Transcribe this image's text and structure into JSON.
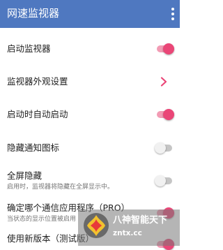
{
  "app": {
    "title": "网速监视器",
    "menu_icon": "more-vert-icon"
  },
  "colors": {
    "appbar": "#4f78c0",
    "accent": "#ea4677"
  },
  "settings": {
    "items": [
      {
        "label": "启动监视器",
        "control": "switch",
        "state": "on"
      },
      {
        "label": "监视器外观设置",
        "control": "chevron-right-icon"
      },
      {
        "label": "启动时自动启动",
        "control": "switch",
        "state": "on"
      },
      {
        "label": "隐藏通知图标",
        "control": "switch",
        "state": "off"
      },
      {
        "label": "全屏隐藏",
        "summary": "启用时，监视器将隐藏在全屏显示中。",
        "control": "switch",
        "state": "off"
      },
      {
        "label": "确定哪个通信应用程序（PRO）",
        "summary": "当状态的显示位置被启用",
        "control": "switch",
        "state": "on"
      },
      {
        "label": "使用新版本（测试版）",
        "control": "switch",
        "state": "on"
      }
    ]
  },
  "watermark": {
    "title": "八神智能天下",
    "url": "zntx.cc",
    "icon": "watermark-logo-icon"
  }
}
